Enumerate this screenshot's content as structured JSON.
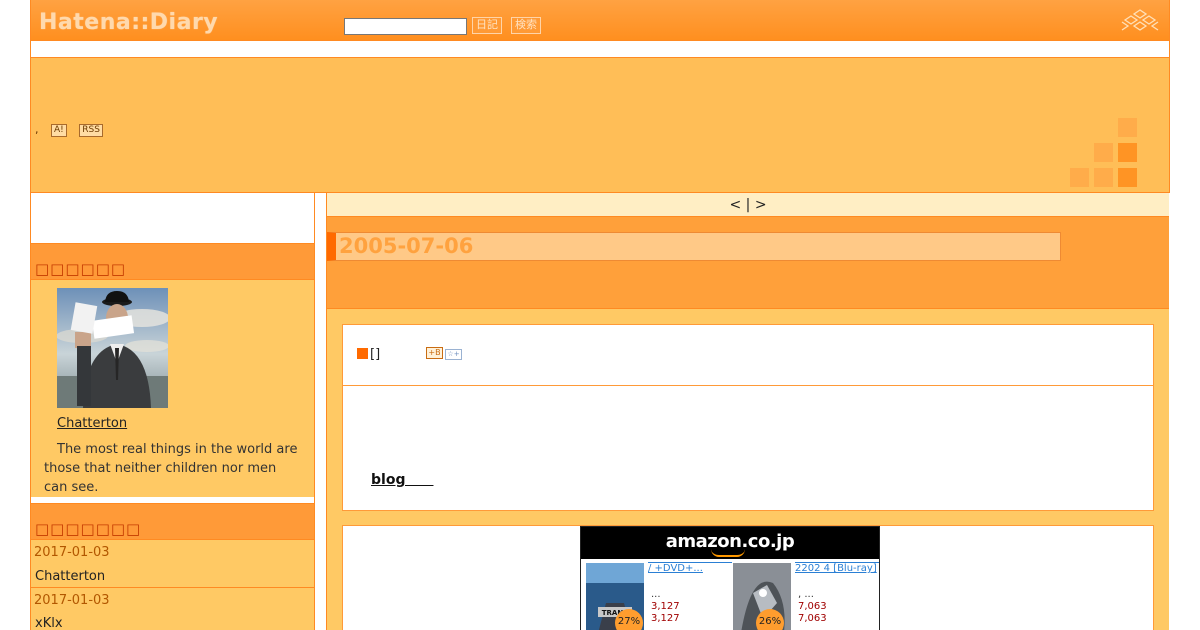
{
  "header": {
    "logo": "Hatena::Diary",
    "search_value": "",
    "diary_button": "日記",
    "search_button": "検索"
  },
  "banner": {
    "comma": ",",
    "badge_a": "A!",
    "badge_rss": "RSS"
  },
  "nav": {
    "prev": "<",
    "sep": "|",
    "next": ">"
  },
  "day": {
    "date": "2005-07-06"
  },
  "sidebar": {
    "profile_heading": "□□□□□□",
    "profile_name": "Chatterton",
    "profile_text": "The most real things in the world are those that neither children nor men can see.",
    "recent_heading": "□□□□□□□",
    "recent": [
      {
        "date": "2017-01-03",
        "name": "Chatterton"
      },
      {
        "date": "2017-01-03",
        "name": "xKlx"
      }
    ]
  },
  "entry": {
    "title_text": "[]",
    "hb_label": "+B",
    "star_label": "☆+",
    "blog_link": "blog　　"
  },
  "amazon": {
    "brand": "amazon.co.jp",
    "products": [
      {
        "title": "/ +DVD+...",
        "ellipsis": "...",
        "price1": "3,127",
        "price2": "3,127",
        "discount": "27%"
      },
      {
        "title": "2202  4 [Blu-ray]",
        "ellipsis": ", ...",
        "price1": "7,063",
        "price2": "7,063",
        "discount": "26%"
      }
    ]
  },
  "colors": {
    "orange": "#ff8f1f",
    "light_orange": "#ffc964",
    "accent": "#ff6a00"
  }
}
